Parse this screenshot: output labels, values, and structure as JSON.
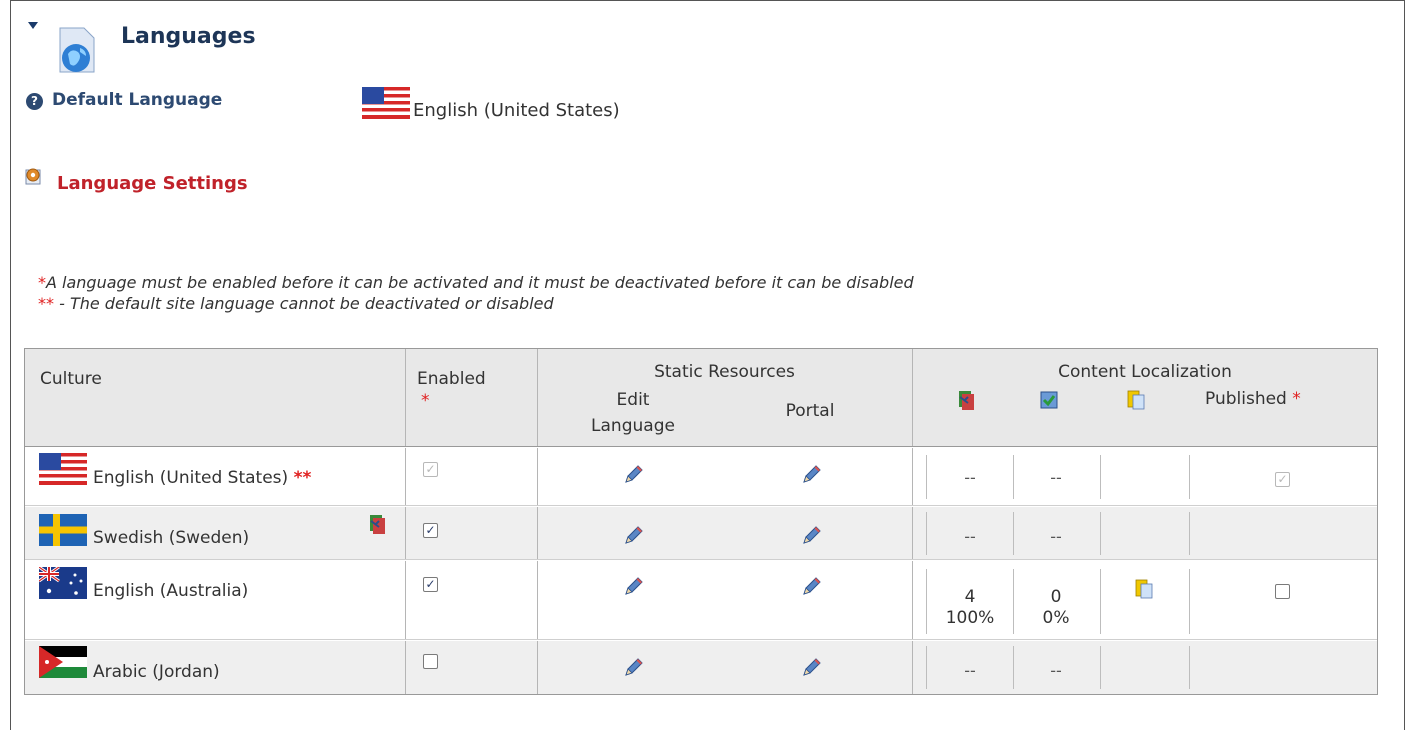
{
  "section": {
    "title": "Languages",
    "icon": "globe-document-icon"
  },
  "default_language": {
    "label": "Default Language",
    "value": "English (United States)"
  },
  "settings": {
    "label": "Language Settings"
  },
  "notes": {
    "note1_star": "*",
    "note1_text": "A language must be enabled before it can be activated and it must be deactivated before it can be disabled",
    "note2_star": "**",
    "note2_text": " - The default site language cannot be deactivated or disabled"
  },
  "grid": {
    "headers": {
      "culture": "Culture",
      "enabled": "Enabled",
      "enabled_star": "*",
      "static_resources": "Static Resources",
      "edit_language": "Edit Language",
      "portal": "Portal",
      "content_localization": "Content Localization",
      "published": "Published",
      "published_star": "*"
    },
    "rows": [
      {
        "culture": "English (United States)",
        "default_mark": "**",
        "flag": "us-flag",
        "enabled": true,
        "enabled_disabled": true,
        "pages": "--",
        "translated": "--",
        "published": true,
        "published_disabled": true
      },
      {
        "culture": "Swedish (Sweden)",
        "flag": "sweden-flag",
        "enabled": true,
        "pages": "--",
        "translated": "--"
      },
      {
        "culture": "English (Australia)",
        "flag": "australia-flag",
        "enabled": true,
        "pages": "4",
        "pages_pct": "100%",
        "translated": "0",
        "translated_pct": "0%",
        "published": false
      },
      {
        "culture": "Arabic (Jordan)",
        "flag": "jordan-flag",
        "enabled": false,
        "pages": "--",
        "translated": "--"
      }
    ]
  },
  "colors": {
    "title": "#1d3557",
    "link": "#c0222a",
    "required": "#e02020",
    "header_bg": "#e8e8e8",
    "alt_row": "#efefef"
  }
}
